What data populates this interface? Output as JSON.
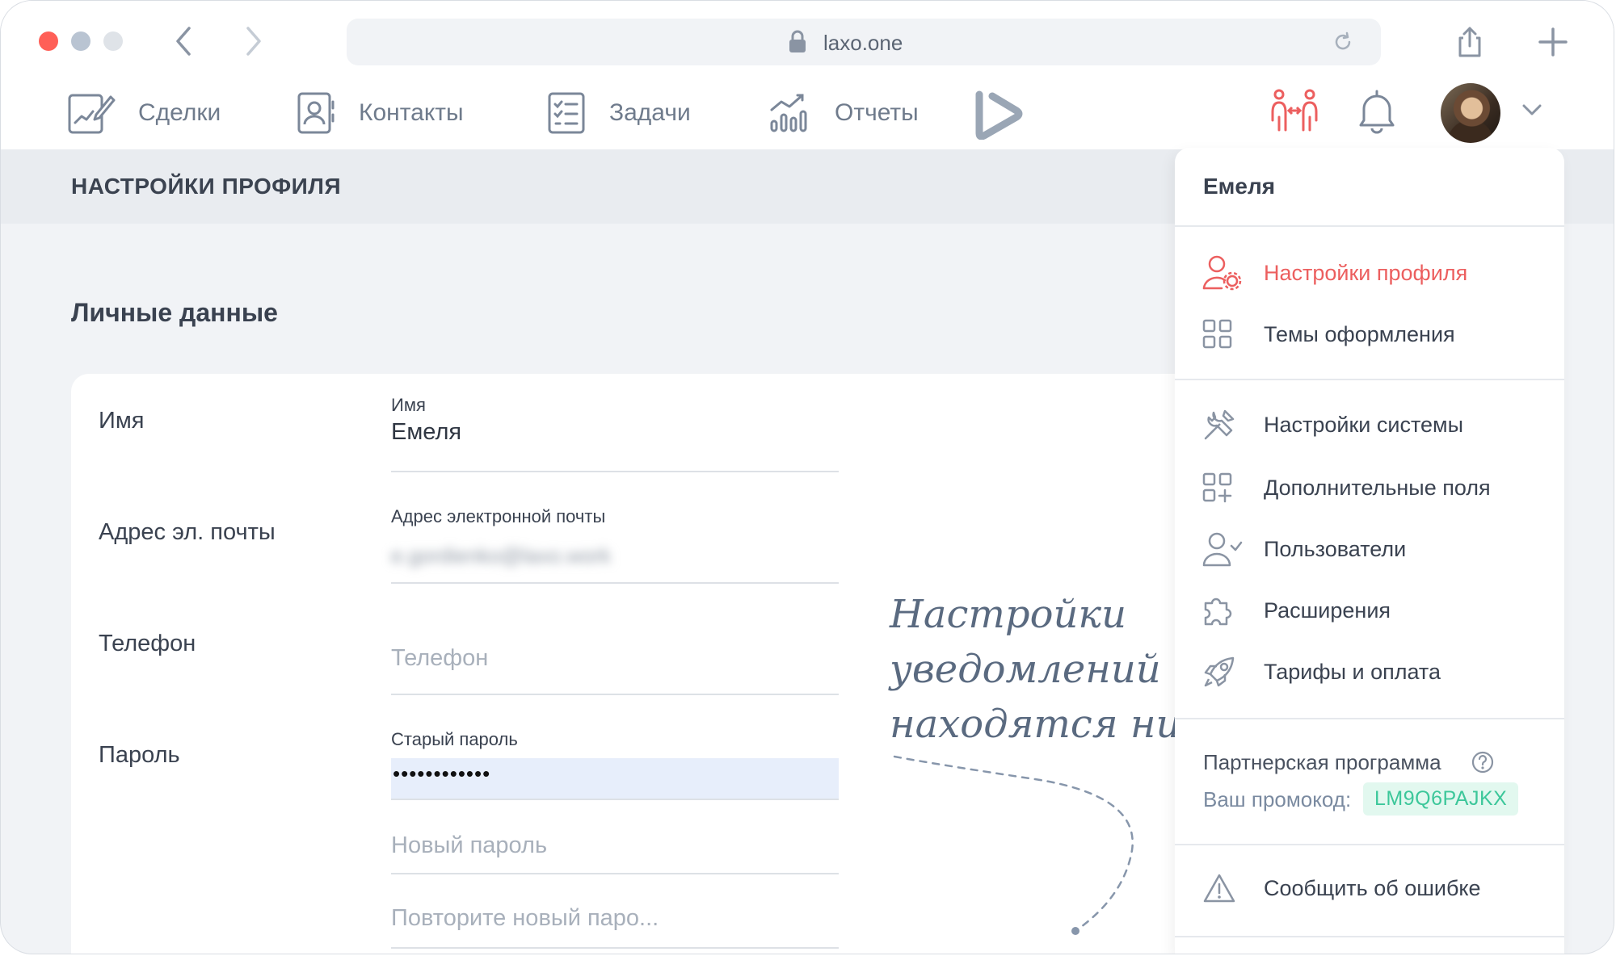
{
  "browser": {
    "url": "laxo.one"
  },
  "nav": {
    "items": [
      {
        "label": "Сделки",
        "icon": "deals-icon"
      },
      {
        "label": "Контакты",
        "icon": "contacts-icon"
      },
      {
        "label": "Задачи",
        "icon": "tasks-icon"
      },
      {
        "label": "Отчеты",
        "icon": "reports-icon"
      }
    ],
    "accent_team_color": "#ec5f5f"
  },
  "page": {
    "title": "НАСТРОЙКИ ПРОФИЛЯ",
    "section_title": "Личные данные"
  },
  "form": {
    "name": {
      "row_label": "Имя",
      "field_label": "Имя",
      "value": "Емеля"
    },
    "email": {
      "row_label": "Адрес эл. почты",
      "field_label": "Адрес электронной почты",
      "value": "e.gordienko@laxo.work"
    },
    "phone": {
      "row_label": "Телефон",
      "placeholder": "Телефон"
    },
    "password": {
      "row_label": "Пароль",
      "old_label": "Старый пароль",
      "old_value": "••••••••••••",
      "new_placeholder": "Новый пароль",
      "repeat_placeholder": "Повторите новый паро..."
    }
  },
  "note": {
    "lines": [
      "Настройки",
      "уведомлений",
      "находятся ниже"
    ]
  },
  "menu": {
    "user_name": "Емеля",
    "items_group1": [
      {
        "label": "Настройки профиля",
        "icon": "user-settings-icon",
        "active": true
      },
      {
        "label": "Темы оформления",
        "icon": "themes-grid-icon"
      }
    ],
    "items_group2": [
      {
        "label": "Настройки системы",
        "icon": "tools-icon"
      },
      {
        "label": "Дополнительные поля",
        "icon": "grid-plus-icon"
      },
      {
        "label": "Пользователи",
        "icon": "user-check-icon"
      },
      {
        "label": "Расширения",
        "icon": "puzzle-icon"
      },
      {
        "label": "Тарифы и оплата",
        "icon": "rocket-icon"
      }
    ],
    "partner_label": "Партнерская программа",
    "promo_label": "Ваш промокод:",
    "promo_code": "LM9Q6PAJKX",
    "report_bug": "Сообщить об ошибке",
    "active_color": "#ec5f5f",
    "promo_color": "#3cc79a"
  }
}
